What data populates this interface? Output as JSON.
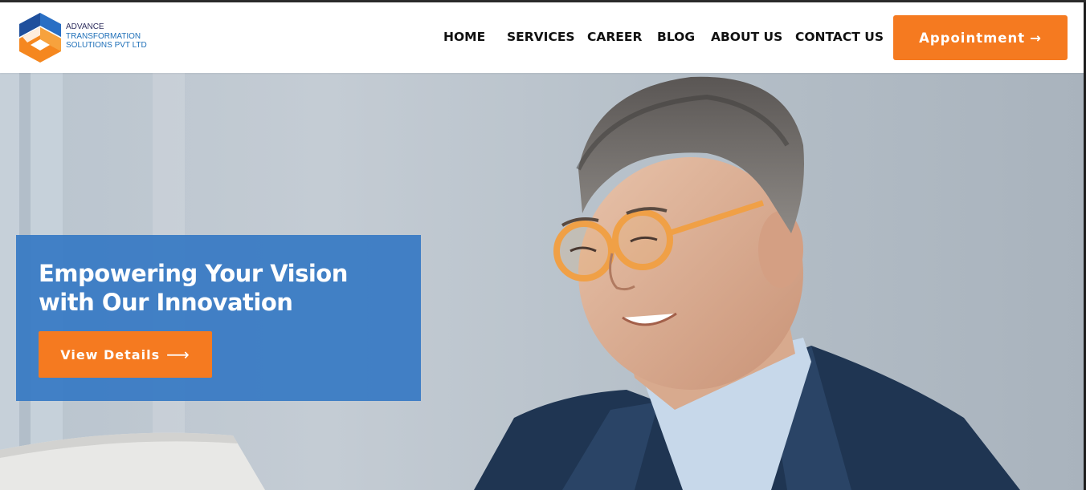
{
  "header": {
    "logo": {
      "line1": "ADVANCE",
      "line2": "TRANSFORMATION",
      "line3": "SOLUTIONS PVT LTD"
    },
    "nav": [
      {
        "label": "HOME"
      },
      {
        "label": "SERVICES"
      },
      {
        "label": "CAREER"
      },
      {
        "label": "BLOG"
      },
      {
        "label": "ABOUT US"
      },
      {
        "label": "CONTACT US"
      }
    ],
    "cta": {
      "label": "Appointment",
      "arrow": "→"
    }
  },
  "hero": {
    "title": "Empowering Your Vision with Our Innovation",
    "button": {
      "label": "View Details",
      "arrow": "⟶"
    },
    "image": "smiling man in orange glasses and navy blazer at laptop"
  },
  "colors": {
    "accent": "#f57a20",
    "card": "#377ac4",
    "logo_blue": "#1e6fb8",
    "nav_text": "#111111"
  }
}
